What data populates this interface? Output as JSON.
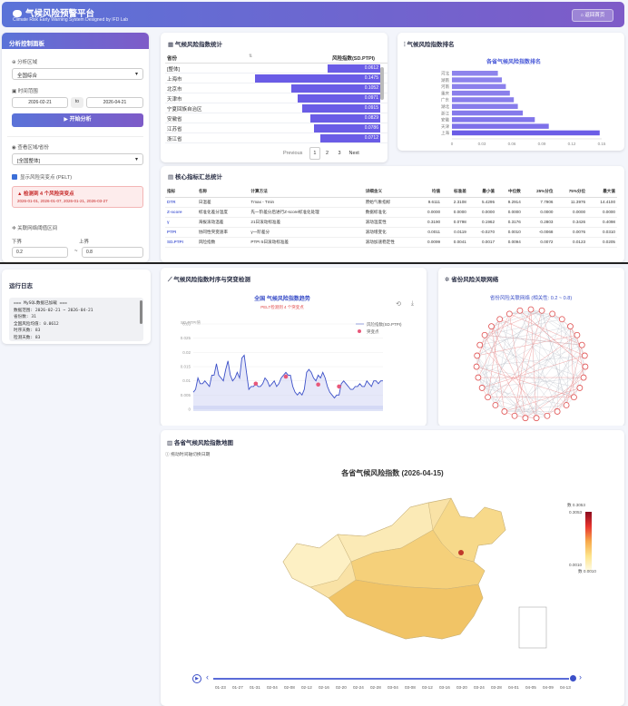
{
  "header": {
    "title": "气候风险预警平台",
    "subtitle": "Climate Risk Early Warning System Designed by IFD Lab",
    "back_button": "返回首页"
  },
  "panel": {
    "title": "分析控制面板",
    "region_label": "分析区域",
    "region_value": "全国综合",
    "time_label": "时间范围",
    "date_start": "2026-02-21",
    "date_to": "to",
    "date_end": "2026-04-21",
    "analyze_button": "▶ 开始分析",
    "view_label": "查看区域/省份",
    "view_value": "[全国整体]",
    "checkbox_label": "显示风险突变点 (PELT)",
    "alert_title": "▲ 检测到 4 个风险突变点",
    "alert_dates": "2026-01-01, 2026-01-07, 2026-01-21, 2026-03-27",
    "threshold_label": "关联网络阈值区间",
    "lower_label": "下界",
    "upper_label": "上界",
    "lower_value": "0.2",
    "upper_value": "0.8",
    "dash": "~"
  },
  "ranking": {
    "title": "气候风险指数统计",
    "col_province": "省份",
    "col_index": "风险指数(SD.PTPI)",
    "rows": [
      {
        "name": "[整体]",
        "value": "0.0612",
        "frac": 0.42
      },
      {
        "name": "上海市",
        "value": "0.1475",
        "frac": 1.0
      },
      {
        "name": "北京市",
        "value": "0.1052",
        "frac": 0.71
      },
      {
        "name": "天津市",
        "value": "0.0971",
        "frac": 0.66
      },
      {
        "name": "宁夏回族自治区",
        "value": "0.0915",
        "frac": 0.62
      },
      {
        "name": "安徽省",
        "value": "0.0829",
        "frac": 0.56
      },
      {
        "name": "江苏省",
        "value": "0.0786",
        "frac": 0.53
      },
      {
        "name": "浙江省",
        "value": "0.0712",
        "frac": 0.48
      }
    ],
    "pager": {
      "prev": "Previous",
      "p1": "1",
      "p2": "2",
      "p3": "3",
      "next": "Next"
    }
  },
  "rank_chart": {
    "title": "气候风险指数排名",
    "chart_title": "各省气候风险指数排名"
  },
  "stats": {
    "title": "核心指标汇总统计",
    "headers": [
      "指标",
      "名称",
      "计算方法",
      "详细含义",
      "均值",
      "标准差",
      "最小值",
      "中位数",
      "25%分位",
      "75%分位",
      "最大值"
    ],
    "rows": [
      [
        "DTR",
        "日温差",
        "Tmax - Tmin",
        "原始气象指标",
        "9.6111",
        "2.3108",
        "5.4295",
        "9.2914",
        "7.7906",
        "11.3976",
        "14.4100"
      ],
      [
        "Z-score",
        "标准化差分温度",
        "先一阶差分后进行Z-score标准化处理",
        "数据标准化",
        "0.0000",
        "0.0000",
        "0.0000",
        "0.0000",
        "0.0000",
        "0.0000",
        "0.0000"
      ],
      [
        "γ",
        "海拔滚动温差",
        "21日滚动标准差",
        "滚动温度性",
        "0.3190",
        "0.0798",
        "0.1962",
        "0.3176",
        "0.2803",
        "0.3426",
        "0.4098"
      ],
      [
        "PTPI",
        "协同性突变速率",
        "γ一阶差分",
        "滚动增变化",
        "0.0011",
        "0.0119",
        "-0.0270",
        "0.0010",
        "-0.0068",
        "0.0076",
        "0.0310"
      ],
      [
        "SD.PTPI",
        "风险指数",
        "PTPI 5日滚动标准差",
        "滚动加速稳定性",
        "0.0099",
        "0.0041",
        "0.0017",
        "0.0094",
        "0.0072",
        "0.0123",
        "0.0205"
      ]
    ]
  },
  "log": {
    "title": "运行日志",
    "lines": [
      "=== MySQL数据已加载 ===",
      "数据范围: 2026-02-21 ~ 2026-04-21",
      "省份数: 31",
      "全国风险均值: 0.0612",
      "时序天数: 83",
      "检测天数: 83"
    ]
  },
  "trend": {
    "title": "气候风险指数时序与突变检测",
    "chart_title": "全国 气候风险指数趋势",
    "chart_subtitle": "PELT检测到 4 个突变点",
    "legend_line": "风险指数(SD.PTPI)",
    "legend_point": "突变点",
    "ylabel": "SD.PTPI值"
  },
  "network": {
    "title": "省份风险关联网络",
    "chart_title": "省份风险关联网络 (相关性: 0.2 ~ 0.8)"
  },
  "map": {
    "title": "各省气候风险指数地图",
    "hint": "拖动时间轴切换日期",
    "chart_title": "各省气候风险指数 (2026-04-15)",
    "legend_max_label": "数 0.3053",
    "legend_max": "0.3053",
    "legend_min": "0.0010",
    "legend_min_label": "数 0.0010",
    "timeline": [
      "01-23",
      "01-27",
      "01-31",
      "02-04",
      "02-08",
      "02-12",
      "02-16",
      "02-20",
      "02-24",
      "02-28",
      "03-04",
      "03-08",
      "03-12",
      "03-16",
      "03-20",
      "03-24",
      "03-28",
      "04-01",
      "04-05",
      "04-09",
      "04-13"
    ]
  },
  "chart_data": [
    {
      "type": "bar",
      "title": "各省气候风险指数排名",
      "orientation": "horizontal",
      "categories": [
        "上海",
        "天津",
        "安徽",
        "浙江",
        "湖北",
        "广东",
        "重庆",
        "河南",
        "湖南",
        "河北"
      ],
      "values": [
        0.148,
        0.097,
        0.083,
        0.071,
        0.066,
        0.062,
        0.058,
        0.054,
        0.05,
        0.046
      ],
      "xlim": [
        0,
        0.15
      ],
      "xticks": [
        "0",
        "0.03",
        "0.06",
        "0.09",
        "0.12",
        "0.15"
      ]
    },
    {
      "type": "line",
      "title": "全国 气候风险指数趋势",
      "subtitle": "PELT检测到 4 个突变点",
      "ylabel": "SD.PTPI值",
      "ylim": [
        0,
        0.03
      ],
      "yticks": [
        "0",
        "0.005",
        "0.01",
        "0.015",
        "0.02",
        "0.025",
        "0.03"
      ],
      "series": [
        {
          "name": "风险指数(SD.PTPI)",
          "values": [
            0.006,
            0.007,
            0.011,
            0.009,
            0.009,
            0.01,
            0.009,
            0.008,
            0.012,
            0.012,
            0.016,
            0.012,
            0.011,
            0.01,
            0.014,
            0.017,
            0.012,
            0.01,
            0.011,
            0.013,
            0.011,
            0.018,
            0.019,
            0.013,
            0.007,
            0.008,
            0.008,
            0.009,
            0.008,
            0.008,
            0.009,
            0.011,
            0.01,
            0.008,
            0.009,
            0.01,
            0.008,
            0.009,
            0.011,
            0.012,
            0.013,
            0.012,
            0.012,
            0.008,
            0.006,
            0.005,
            0.006,
            0.005,
            0.007,
            0.013,
            0.014,
            0.013,
            0.011,
            0.01,
            0.012,
            0.011,
            0.013,
            0.011,
            0.008,
            0.006,
            0.005,
            0.004,
            0.005,
            0.005,
            0.009,
            0.01,
            0.009,
            0.008,
            0.007,
            0.007,
            0.008,
            0.008,
            0.009,
            0.008,
            0.008,
            0.01,
            0.009,
            0.008,
            0.01,
            0.01,
            0.009,
            0.01,
            0.01
          ]
        },
        {
          "name": "突变点",
          "points": [
            [
              27,
              0.009
            ],
            [
              40,
              0.0115
            ],
            [
              54,
              0.0087
            ],
            [
              63,
              0.008
            ]
          ]
        }
      ]
    }
  ]
}
